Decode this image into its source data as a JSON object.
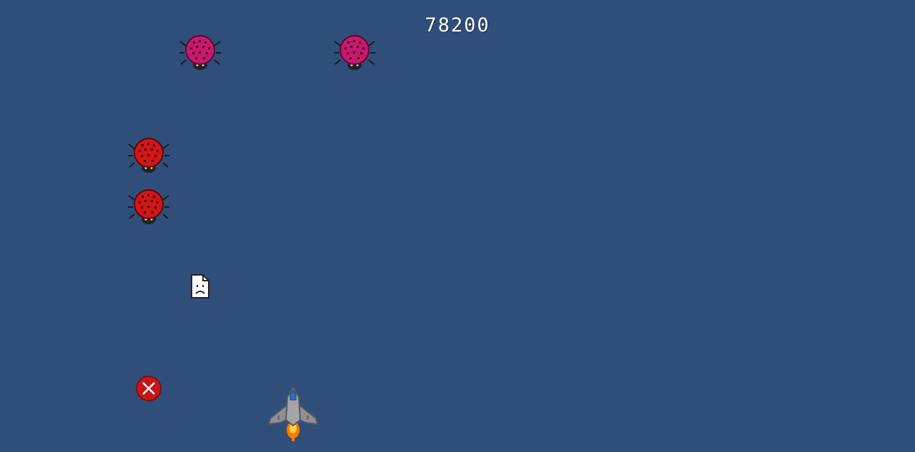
{
  "hud": {
    "score": "78200"
  },
  "enemies": [
    {
      "kind": "ladybug",
      "color": "#c8186e"
    },
    {
      "kind": "ladybug",
      "color": "#c8186e"
    },
    {
      "kind": "ladybug",
      "color": "#d41515"
    },
    {
      "kind": "ladybug",
      "color": "#d41515"
    }
  ],
  "pickups": [
    {
      "kind": "broken-image-icon"
    },
    {
      "kind": "red-mine-x",
      "color": "#c41818"
    }
  ],
  "player": {
    "kind": "spaceship",
    "body_color": "#8e9096",
    "cockpit_color": "#2a6fc0",
    "flame_color": "#ff7a00"
  },
  "colors": {
    "background": "#304e7a",
    "score_text": "#ffffff"
  }
}
